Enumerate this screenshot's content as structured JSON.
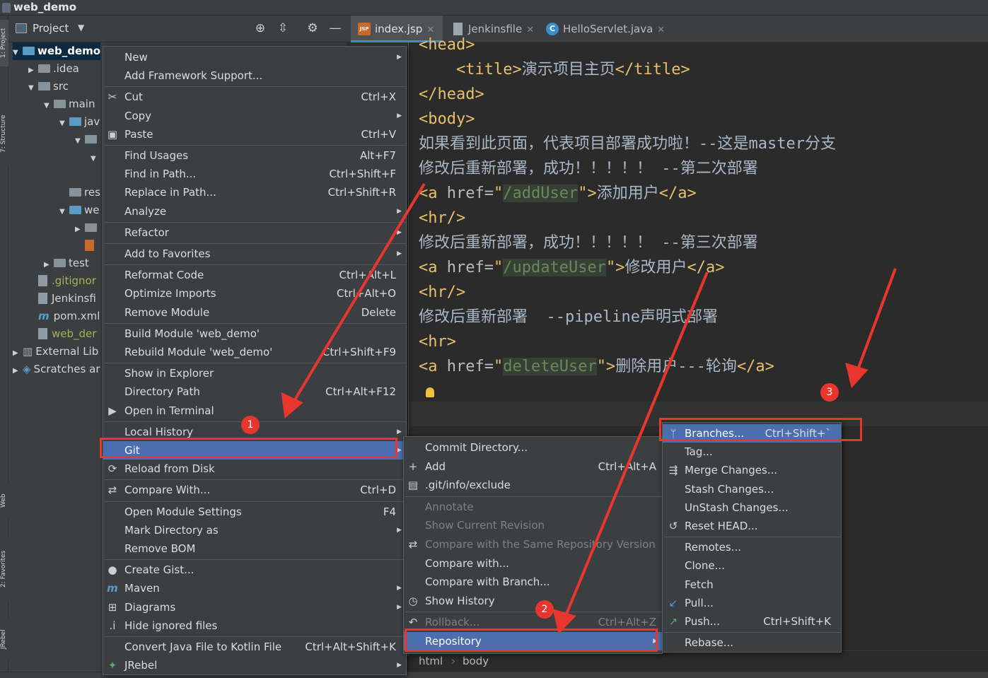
{
  "window": {
    "title": "web_demo"
  },
  "left_tabs": [
    "1: Project",
    "7: Structure",
    "Web",
    "2: Favorites",
    "JRebel"
  ],
  "project": {
    "header": "Project",
    "tree": [
      {
        "label": "web_demo",
        "depth": 0,
        "twisty": "▼",
        "kind": "module"
      },
      {
        "label": ".idea",
        "depth": 1,
        "twisty": "▶",
        "kind": "folder"
      },
      {
        "label": "src",
        "depth": 1,
        "twisty": "▼",
        "kind": "folder"
      },
      {
        "label": "main",
        "depth": 2,
        "twisty": "▼",
        "kind": "folder"
      },
      {
        "label": "jav",
        "depth": 3,
        "twisty": "▼",
        "kind": "folder-blue"
      },
      {
        "label": "",
        "depth": 4,
        "twisty": "▼",
        "kind": "folder"
      },
      {
        "label": "",
        "depth": 5,
        "twisty": "▼",
        "kind": "none"
      },
      {
        "label": "",
        "depth": 0,
        "twisty": "",
        "kind": "none"
      },
      {
        "label": "res",
        "depth": 3,
        "twisty": "",
        "kind": "folder"
      },
      {
        "label": "we",
        "depth": 3,
        "twisty": "▼",
        "kind": "folder-blue"
      },
      {
        "label": "",
        "depth": 4,
        "twisty": "▶",
        "kind": "folder"
      },
      {
        "label": "",
        "depth": 4,
        "twisty": "",
        "kind": "jsp"
      },
      {
        "label": "test",
        "depth": 2,
        "twisty": "▶",
        "kind": "folder"
      },
      {
        "label": ".gitignor",
        "depth": 1,
        "twisty": "",
        "kind": "git"
      },
      {
        "label": "Jenkinsfi",
        "depth": 1,
        "twisty": "",
        "kind": "file"
      },
      {
        "label": "pom.xml",
        "depth": 1,
        "twisty": "",
        "kind": "maven"
      },
      {
        "label": "web_der",
        "depth": 1,
        "twisty": "",
        "kind": "git"
      },
      {
        "label": "External Lib",
        "depth": 0,
        "twisty": "▶",
        "kind": "lib"
      },
      {
        "label": "Scratches ar",
        "depth": 0,
        "twisty": "▶",
        "kind": "scratch"
      }
    ]
  },
  "tabs": [
    {
      "label": "index.jsp",
      "icon": "jsp-icon",
      "active": true
    },
    {
      "label": "Jenkinsfile",
      "icon": "file-icon",
      "active": false
    },
    {
      "label": "HelloServlet.java",
      "icon": "class-icon",
      "active": false
    }
  ],
  "editor": {
    "lines": [
      [
        [
          "tg",
          "<head>"
        ]
      ],
      [
        [
          "tx",
          "    "
        ],
        [
          "tg",
          "<title>"
        ],
        [
          "tx",
          "演示项目主页"
        ],
        [
          "tg",
          "</title>"
        ]
      ],
      [
        [
          "tg",
          "</head>"
        ]
      ],
      [
        [
          "tg",
          "<body>"
        ]
      ],
      [
        [
          "tx",
          "如果看到此页面，代表项目部署成功啦！--这是master分支"
        ]
      ],
      [
        [
          "tx",
          "修改后重新部署，成功！！！！！ --第二次部署"
        ]
      ],
      [
        [
          "tg",
          "<a "
        ],
        [
          "at",
          "href="
        ],
        [
          "tg",
          "\""
        ],
        [
          "sv",
          "/addUser"
        ],
        [
          "tg",
          "\">"
        ],
        [
          "tx",
          "添加用户"
        ],
        [
          "tg",
          "</a>"
        ]
      ],
      [
        [
          "tg",
          "<hr/>"
        ]
      ],
      [
        [
          "tx",
          "修改后重新部署，成功！！！！！ --第三次部署"
        ]
      ],
      [
        [
          "tg",
          "<a "
        ],
        [
          "at",
          "href="
        ],
        [
          "tg",
          "\""
        ],
        [
          "sv",
          "/updateUser"
        ],
        [
          "tg",
          "\">"
        ],
        [
          "tx",
          "修改用户"
        ],
        [
          "tg",
          "</a>"
        ]
      ],
      [
        [
          "tg",
          "<hr/>"
        ]
      ],
      [
        [
          "tx",
          "修改后重新部署  --pipeline声明式部署"
        ]
      ],
      [
        [
          "tg",
          "<hr>"
        ]
      ],
      [
        [
          "tg",
          "<a "
        ],
        [
          "at",
          "href="
        ],
        [
          "tg",
          "\""
        ],
        [
          "sv",
          "deleteUser"
        ],
        [
          "tg",
          "\">"
        ],
        [
          "tx",
          "删除用户---轮询"
        ],
        [
          "tg",
          "</a>"
        ]
      ]
    ]
  },
  "breadcrumb": [
    "html",
    "body"
  ],
  "context_menu": {
    "items": [
      {
        "label": "New",
        "shortcut": "",
        "submenu": true,
        "icon": ""
      },
      {
        "label": "Add Framework Support...",
        "shortcut": "",
        "submenu": false,
        "icon": ""
      },
      {
        "sep": true
      },
      {
        "label": "Cut",
        "shortcut": "Ctrl+X",
        "submenu": false,
        "icon": "scissors-icon"
      },
      {
        "label": "Copy",
        "shortcut": "",
        "submenu": true,
        "icon": ""
      },
      {
        "label": "Paste",
        "shortcut": "Ctrl+V",
        "submenu": false,
        "icon": "clipboard-icon"
      },
      {
        "sep": true
      },
      {
        "label": "Find Usages",
        "shortcut": "Alt+F7",
        "submenu": false,
        "icon": ""
      },
      {
        "label": "Find in Path...",
        "shortcut": "Ctrl+Shift+F",
        "submenu": false,
        "icon": ""
      },
      {
        "label": "Replace in Path...",
        "shortcut": "Ctrl+Shift+R",
        "submenu": false,
        "icon": ""
      },
      {
        "label": "Analyze",
        "shortcut": "",
        "submenu": true,
        "icon": ""
      },
      {
        "sep": true
      },
      {
        "label": "Refactor",
        "shortcut": "",
        "submenu": true,
        "icon": ""
      },
      {
        "sep": true
      },
      {
        "label": "Add to Favorites",
        "shortcut": "",
        "submenu": true,
        "icon": ""
      },
      {
        "sep": true
      },
      {
        "label": "Reformat Code",
        "shortcut": "Ctrl+Alt+L",
        "submenu": false,
        "icon": ""
      },
      {
        "label": "Optimize Imports",
        "shortcut": "Ctrl+Alt+O",
        "submenu": false,
        "icon": ""
      },
      {
        "label": "Remove Module",
        "shortcut": "Delete",
        "submenu": false,
        "icon": ""
      },
      {
        "sep": true
      },
      {
        "label": "Build Module 'web_demo'",
        "shortcut": "",
        "submenu": false,
        "icon": ""
      },
      {
        "label": "Rebuild Module 'web_demo'",
        "shortcut": "Ctrl+Shift+F9",
        "submenu": false,
        "icon": ""
      },
      {
        "sep": true
      },
      {
        "label": "Show in Explorer",
        "shortcut": "",
        "submenu": false,
        "icon": ""
      },
      {
        "label": "Directory Path",
        "shortcut": "Ctrl+Alt+F12",
        "submenu": false,
        "icon": ""
      },
      {
        "label": "Open in Terminal",
        "shortcut": "",
        "submenu": false,
        "icon": "terminal-icon"
      },
      {
        "sep": true
      },
      {
        "label": "Local History",
        "shortcut": "",
        "submenu": true,
        "icon": ""
      },
      {
        "label": "Git",
        "shortcut": "",
        "submenu": true,
        "icon": "",
        "highlight": true
      },
      {
        "label": "Reload from Disk",
        "shortcut": "",
        "submenu": false,
        "icon": "reload-icon"
      },
      {
        "sep": true
      },
      {
        "label": "Compare With...",
        "shortcut": "Ctrl+D",
        "submenu": false,
        "icon": "compare-icon"
      },
      {
        "sep": true
      },
      {
        "label": "Open Module Settings",
        "shortcut": "F4",
        "submenu": false,
        "icon": ""
      },
      {
        "label": "Mark Directory as",
        "shortcut": "",
        "submenu": true,
        "icon": ""
      },
      {
        "label": "Remove BOM",
        "shortcut": "",
        "submenu": false,
        "icon": ""
      },
      {
        "sep": true
      },
      {
        "label": "Create Gist...",
        "shortcut": "",
        "submenu": false,
        "icon": "github-icon"
      },
      {
        "label": "Maven",
        "shortcut": "",
        "submenu": true,
        "icon": "maven-icon"
      },
      {
        "label": "Diagrams",
        "shortcut": "",
        "submenu": true,
        "icon": "diagram-icon"
      },
      {
        "label": "Hide ignored files",
        "shortcut": "",
        "submenu": false,
        "icon": "ignore-icon"
      },
      {
        "sep": true
      },
      {
        "label": "Convert Java File to Kotlin File",
        "shortcut": "Ctrl+Alt+Shift+K",
        "submenu": false,
        "icon": ""
      },
      {
        "label": "JRebel",
        "shortcut": "",
        "submenu": true,
        "icon": "jrebel-icon"
      }
    ]
  },
  "git_menu": {
    "items": [
      {
        "label": "Commit Directory...",
        "shortcut": "",
        "submenu": false,
        "icon": ""
      },
      {
        "label": "Add",
        "shortcut": "Ctrl+Alt+A",
        "submenu": false,
        "icon": "plus-icon"
      },
      {
        "label": ".git/info/exclude",
        "shortcut": "",
        "submenu": false,
        "icon": "exclude-icon"
      },
      {
        "sep": true
      },
      {
        "label": "Annotate",
        "shortcut": "",
        "submenu": false,
        "icon": "",
        "disabled": true
      },
      {
        "label": "Show Current Revision",
        "shortcut": "",
        "submenu": false,
        "icon": "",
        "disabled": true
      },
      {
        "label": "Compare with the Same Repository Version",
        "shortcut": "",
        "submenu": false,
        "icon": "compare-icon",
        "disabled": true
      },
      {
        "label": "Compare with...",
        "shortcut": "",
        "submenu": false,
        "icon": ""
      },
      {
        "label": "Compare with Branch...",
        "shortcut": "",
        "submenu": false,
        "icon": ""
      },
      {
        "label": "Show History",
        "shortcut": "",
        "submenu": false,
        "icon": "history-icon"
      },
      {
        "sep": true
      },
      {
        "label": "Rollback...",
        "shortcut": "Ctrl+Alt+Z",
        "submenu": false,
        "icon": "rollback-icon",
        "disabled": true
      },
      {
        "label": "Repository",
        "shortcut": "",
        "submenu": true,
        "icon": "",
        "highlight": true
      }
    ]
  },
  "repo_menu": {
    "items": [
      {
        "label": "Branches...",
        "shortcut": "Ctrl+Shift+`",
        "submenu": false,
        "icon": "branch-icon",
        "highlight": true
      },
      {
        "label": "Tag...",
        "shortcut": "",
        "submenu": false,
        "icon": ""
      },
      {
        "label": "Merge Changes...",
        "shortcut": "",
        "submenu": false,
        "icon": "merge-icon"
      },
      {
        "label": "Stash Changes...",
        "shortcut": "",
        "submenu": false,
        "icon": ""
      },
      {
        "label": "UnStash Changes...",
        "shortcut": "",
        "submenu": false,
        "icon": ""
      },
      {
        "label": "Reset HEAD...",
        "shortcut": "",
        "submenu": false,
        "icon": "reset-icon"
      },
      {
        "sep": true
      },
      {
        "label": "Remotes...",
        "shortcut": "",
        "submenu": false,
        "icon": ""
      },
      {
        "label": "Clone...",
        "shortcut": "",
        "submenu": false,
        "icon": ""
      },
      {
        "label": "Fetch",
        "shortcut": "",
        "submenu": false,
        "icon": ""
      },
      {
        "label": "Pull...",
        "shortcut": "",
        "submenu": false,
        "icon": "pull-icon"
      },
      {
        "label": "Push...",
        "shortcut": "Ctrl+Shift+K",
        "submenu": false,
        "icon": "push-icon"
      },
      {
        "sep": true
      },
      {
        "label": "Rebase...",
        "shortcut": "",
        "submenu": false,
        "icon": ""
      }
    ]
  },
  "annotations": {
    "badges": [
      "1",
      "2",
      "3"
    ],
    "color": "#e8352e"
  },
  "colors": {
    "highlight": "#4b6eaf",
    "tag": "#e8bf6a",
    "string": "#6a8759",
    "panel": "#3c3f41",
    "editor": "#2b2b2b"
  }
}
